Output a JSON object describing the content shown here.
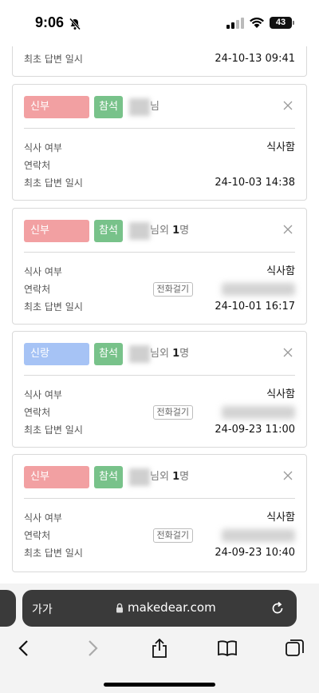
{
  "status": {
    "time": "9:06",
    "battery": "43"
  },
  "top_partial": {
    "label": "최초 답변 일시",
    "value": "24-10-13 09:41"
  },
  "cards": [
    {
      "role": "신부",
      "attend": "참석",
      "name_suffix": "님",
      "extra": "",
      "extra_count": "",
      "meal_label": "식사 여부",
      "meal": "식사함",
      "contact_label": "연락처",
      "call_button": "",
      "time_label": "최초 답변 일시",
      "time": "24-10-03 14:38"
    },
    {
      "role": "신부",
      "attend": "참석",
      "name_suffix": "님외 ",
      "extra_count": "1",
      "extra": "명",
      "meal_label": "식사 여부",
      "meal": "식사함",
      "contact_label": "연락처",
      "call_button": "전화걸기",
      "time_label": "최초 답변 일시",
      "time": "24-10-01 16:17"
    },
    {
      "role": "신랑",
      "attend": "참석",
      "name_suffix": "님외 ",
      "extra_count": "1",
      "extra": "명",
      "meal_label": "식사 여부",
      "meal": "식사함",
      "contact_label": "연락처",
      "call_button": "전화걸기",
      "time_label": "최초 답변 일시",
      "time": "24-09-23 11:00"
    },
    {
      "role": "신부",
      "attend": "참석",
      "name_suffix": "님외 ",
      "extra_count": "1",
      "extra": "명",
      "meal_label": "식사 여부",
      "meal": "식사함",
      "contact_label": "연락처",
      "call_button": "전화걸기",
      "time_label": "최초 답변 일시",
      "time": "24-09-23 10:40"
    }
  ],
  "browser": {
    "aa": "가가",
    "url": "makedear.com"
  },
  "colors": {
    "bride": "#f2a0a2",
    "groom": "#a6c3f5",
    "attend": "#78c28a"
  }
}
